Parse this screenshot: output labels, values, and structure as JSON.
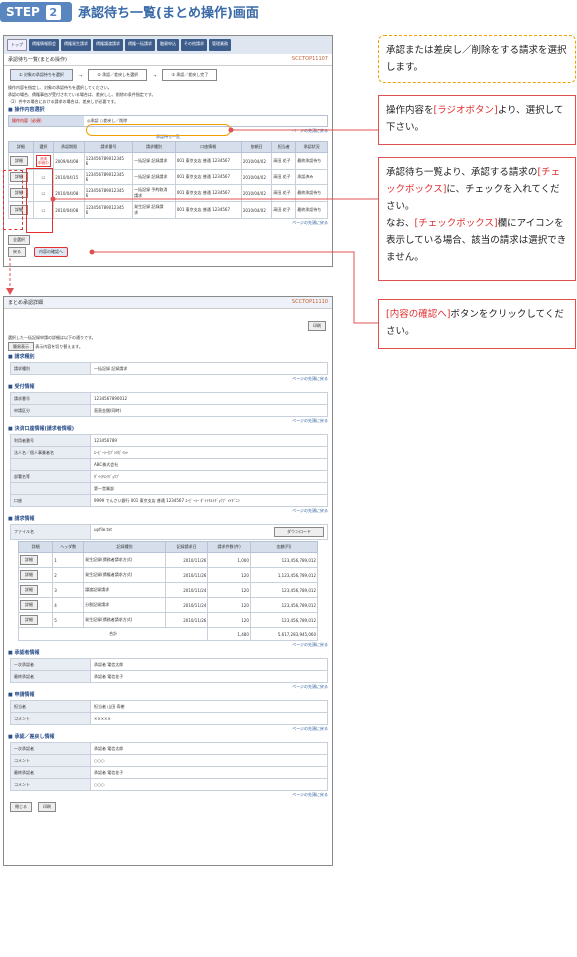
{
  "step": {
    "label": "STEP",
    "number": "2",
    "title": "承認待ち一覧(まとめ操作)画面"
  },
  "callouts": {
    "c1": "承認または差戻し／削除をする請求を選択します。",
    "c2_a": "操作内容を",
    "c2_b": "[ラジオボタン]",
    "c2_c": "より、選択して下さい。",
    "c3_a": "承認待ち一覧より、承認する請求の",
    "c3_b": "[チェックボックス]",
    "c3_c": "に、チェックを入れてください。",
    "c3_d": "なお、",
    "c3_e": "[チェックボックス]",
    "c3_f": "欄にアイコンを表示している場合、該当の請求は選択できません。",
    "c4_a": "[内容の確認へ]",
    "c4_b": "ボタンをクリックしてください。"
  },
  "top": {
    "nav": [
      "トップ",
      "債権情報照会",
      "債権発生請求",
      "債権譲渡請求",
      "債権一括請求",
      "融資申込",
      "その他請求",
      "管理業務"
    ],
    "title": "承認待ち一覧(まとめ操作)",
    "screen_id": "SCCTOP11107",
    "steps": [
      "① 対象の承認待ちを選択",
      "② 承認／差戻しを選択",
      "③ 承認／差戻し完了"
    ],
    "note1": "操作内容を指定し、対象の承認待ちを選択してください。",
    "note2": "承認の場合、債権事由が受付されている場合は、差戻しし、削除の条件指定です。",
    "note3": "（2）件中の場合における請求の場合は、差戻しが必要です。",
    "sec_op": "操作内容選択",
    "op_key": "操作内容（必須）",
    "op_val": "◎承認 ○差戻し／削除",
    "link_top": "ページの先頭に戻る",
    "list_title": "承認待ち一覧",
    "cols": [
      "詳細",
      "選択",
      "承認期限",
      "請求番号",
      "請求種別",
      "口座情報",
      "依頼日",
      "担当者",
      "承認状況"
    ],
    "rows": [
      [
        "詳細",
        "",
        "2009/04/08",
        "123456789012345\n6",
        "一括記録 記録請求",
        "001 東京支店 普通 1234567",
        "2010/04/02",
        "高田 花子",
        "最終承認待ち"
      ],
      [
        "詳細",
        "☐",
        "2010/04/15",
        "123456789012345\n6",
        "一括記録 記録請求",
        "001 東京支店 普通 1234567",
        "2010/04/02",
        "高田 花子",
        "承認済み"
      ],
      [
        "詳細",
        "☐",
        "2010/04/08",
        "123456789012345\n6",
        "一括記録 予約取消\n請求",
        "001 東京支店 普通 1234567",
        "2010/04/02",
        "高田 花子",
        "最終承認待ち"
      ],
      [
        "詳細",
        "☐",
        "2010/04/08",
        "123456789012345\n6",
        "発生記録 記録請\n求",
        "001 東京支店 普通 1234567",
        "2010/04/02",
        "高田 花子",
        "最終承認待ち"
      ]
    ],
    "icon_label": "決済\n申請中",
    "select_all": "全選択",
    "back": "戻る",
    "confirm": "内容の確認へ"
  },
  "bottom": {
    "title": "まとめ承認詳細",
    "screen_id": "SCCTOP11110",
    "print": "印刷",
    "note": "選択した一括記録申請の詳細は以下の通りです。",
    "tab_btn": "簡易表示",
    "tab_note": "表示内容を切り替えます。",
    "link": "ページの先頭に戻る",
    "s1": "請求種別",
    "s1_rows": [
      [
        "請求種別",
        "一括記録 記録請求"
      ]
    ],
    "s2": "受付情報",
    "s2_rows": [
      [
        "請求番号",
        "1234567890012"
      ],
      [
        "申請区分",
        "直直金銭(同時)"
      ]
    ],
    "s3": "決済口座情報(請求者情報)",
    "s3_rows": [
      [
        "利用者番号",
        "123456789"
      ],
      [
        "法人名／個人事業者名",
        "ｴｰﾋﾞｰｼｰｶﾌﾞｼｷｶﾞｲｼｬ"
      ],
      [
        "",
        "ABC株式会社"
      ],
      [
        "部署名等",
        "ﾀﾞｲｲﾁｴｲｷﾞｮｳﾌﾞ"
      ],
      [
        "",
        "第一営業部"
      ],
      [
        "口座",
        "9999 でんさい銀行 001 東京支店 普通 1234567 ｴｰﾋﾞｰｼｰ ﾀﾞｲｲﾁｴｲｷﾞｮｳﾌﾞ ﾒｲｷﾞﾆﾝ"
      ]
    ],
    "s4": "請求情報",
    "file_label": "ファイル名",
    "file_name": "upfile.txt",
    "download": "ダウンロード",
    "req_cols": [
      "詳細",
      "ヘッダ数",
      "記録種別",
      "記録請求日",
      "請求件数(件)",
      "金額(円)"
    ],
    "req_rows": [
      [
        "詳細",
        "1",
        "発生記録(債務者請求方式)",
        "2010/11/26",
        "1,000",
        "123,456,789,012"
      ],
      [
        "詳細",
        "2",
        "発生記録(債権者請求方式)",
        "2010/11/26",
        "120",
        "1,123,456,789,012"
      ],
      [
        "詳細",
        "3",
        "譲渡記録請求",
        "2010/11/24",
        "120",
        "123,456,789,012"
      ],
      [
        "詳細",
        "4",
        "分割記録請求",
        "2010/11/24",
        "120",
        "123,456,789,012"
      ],
      [
        "詳細",
        "5",
        "発生記録(債務者請求方式)",
        "2010/11/26",
        "120",
        "123,456,789,012"
      ]
    ],
    "total_label": "合計",
    "total_count": "1,480",
    "total_amount": "5,617,283,945,060",
    "s5": "承認者情報",
    "s5_rows": [
      [
        "一次承認者",
        "承認者 電信太郎"
      ],
      [
        "最終承認者",
        "承認者 電信花子"
      ]
    ],
    "s6": "申請情報",
    "s6_rows": [
      [
        "担当者",
        "担当者 山田 寿樹"
      ],
      [
        "コメント",
        "×××××"
      ]
    ],
    "s7": "承認／差戻し情報",
    "s7_rows": [
      [
        "一次承認者",
        "承認者 電信太郎"
      ],
      [
        "コメント",
        "○○○"
      ],
      [
        "最終承認者",
        "承認者 電信花子"
      ],
      [
        "コメント",
        "○○○"
      ]
    ],
    "close": "閉じる",
    "print2": "印刷"
  },
  "colors": {
    "accent": "#5a86c0",
    "callout": "#e05050",
    "dotted": "#f0a000"
  }
}
